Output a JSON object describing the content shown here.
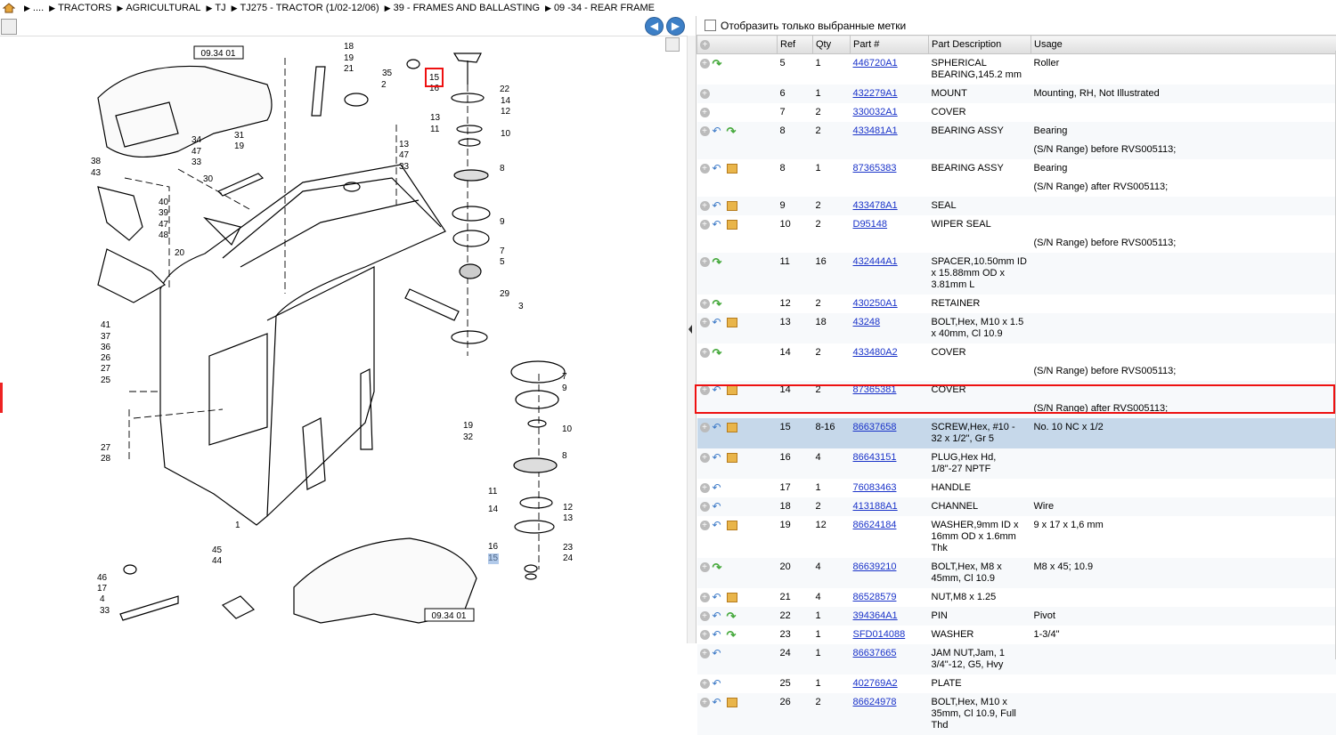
{
  "breadcrumb": [
    "....",
    "TRACTORS",
    "AGRICULTURAL",
    "TJ",
    "TJ275 - TRACTOR (1/02-12/06)",
    "39 - FRAMES AND BALLASTING",
    "09 -34 - REAR FRAME"
  ],
  "filter_label": "Отобразить только выбранные метки",
  "columns": [
    "Ref",
    "Qty",
    "Part #",
    "Part Description",
    "Usage"
  ],
  "drawing": {
    "ref_top": "09.34 01",
    "ref_bottom": "09.34 01",
    "callouts": [
      "18",
      "19",
      "21",
      "35",
      "2",
      "15",
      "16",
      "22",
      "14",
      "12",
      "13",
      "11",
      "10",
      "8",
      "9",
      "7",
      "5",
      "29",
      "3",
      "34",
      "47",
      "33",
      "31",
      "19",
      "38",
      "43",
      "30",
      "40",
      "39",
      "47",
      "48",
      "20",
      "13",
      "47",
      "33",
      "41",
      "37",
      "36",
      "26",
      "27",
      "25",
      "27",
      "28",
      "1",
      "7",
      "9",
      "10",
      "19",
      "32",
      "8",
      "11",
      "12",
      "13",
      "14",
      "16",
      "15",
      "23",
      "24",
      "45",
      "44",
      "46",
      "17",
      "4",
      "33"
    ]
  },
  "rows": [
    {
      "icons": [
        "plus",
        "fwd"
      ],
      "ref": "5",
      "qty": "1",
      "part": "446720A1",
      "desc": "SPHERICAL BEARING,145.2 mm",
      "usage": "Roller"
    },
    {
      "icons": [
        "plus"
      ],
      "ref": "6",
      "qty": "1",
      "part": "432279A1",
      "desc": "MOUNT",
      "usage": "Mounting, RH, Not Illustrated"
    },
    {
      "icons": [
        "plus"
      ],
      "ref": "7",
      "qty": "2",
      "part": "330032A1",
      "desc": "COVER",
      "usage": ""
    },
    {
      "icons": [
        "plus",
        "back",
        "fwd"
      ],
      "ref": "8",
      "qty": "2",
      "part": "433481A1",
      "desc": "BEARING ASSY",
      "usage": "Bearing"
    },
    {
      "note": "(S/N Range) before RVS005113;"
    },
    {
      "icons": [
        "plus",
        "back",
        "box"
      ],
      "ref": "8",
      "qty": "1",
      "part": "87365383",
      "desc": "BEARING ASSY",
      "usage": "Bearing"
    },
    {
      "note": "(S/N Range) after RVS005113;"
    },
    {
      "icons": [
        "plus",
        "back",
        "box"
      ],
      "ref": "9",
      "qty": "2",
      "part": "433478A1",
      "desc": "SEAL",
      "usage": ""
    },
    {
      "icons": [
        "plus",
        "back",
        "box"
      ],
      "ref": "10",
      "qty": "2",
      "part": "D95148",
      "desc": "WIPER SEAL",
      "usage": ""
    },
    {
      "note": "(S/N Range) before RVS005113;"
    },
    {
      "icons": [
        "plus",
        "fwd"
      ],
      "ref": "11",
      "qty": "16",
      "part": "432444A1",
      "desc": "SPACER,10.50mm ID x 15.88mm OD x 3.81mm L",
      "usage": ""
    },
    {
      "icons": [
        "plus",
        "fwd"
      ],
      "ref": "12",
      "qty": "2",
      "part": "430250A1",
      "desc": "RETAINER",
      "usage": ""
    },
    {
      "icons": [
        "plus",
        "back",
        "box"
      ],
      "ref": "13",
      "qty": "18",
      "part": "43248",
      "desc": "BOLT,Hex, M10 x 1.5 x 40mm, Cl 10.9",
      "usage": ""
    },
    {
      "icons": [
        "plus",
        "fwd"
      ],
      "ref": "14",
      "qty": "2",
      "part": "433480A2",
      "desc": "COVER",
      "usage": ""
    },
    {
      "note": "(S/N Range) before RVS005113;"
    },
    {
      "icons": [
        "plus",
        "back",
        "box"
      ],
      "ref": "14",
      "qty": "2",
      "part": "87365381",
      "desc": "COVER",
      "usage": ""
    },
    {
      "note": "(S/N Range) after RVS005113;"
    },
    {
      "icons": [
        "plus",
        "back",
        "box"
      ],
      "ref": "15",
      "qty": "8-16",
      "part": "86637658",
      "desc": "SCREW,Hex, #10 - 32 x 1/2\", Gr 5",
      "usage": "No. 10 NC x 1/2",
      "selected": true
    },
    {
      "icons": [
        "plus",
        "back",
        "box"
      ],
      "ref": "16",
      "qty": "4",
      "part": "86643151",
      "desc": "PLUG,Hex Hd, 1/8\"-27 NPTF",
      "usage": ""
    },
    {
      "icons": [
        "plus",
        "back"
      ],
      "ref": "17",
      "qty": "1",
      "part": "76083463",
      "desc": "HANDLE",
      "usage": ""
    },
    {
      "icons": [
        "plus",
        "back"
      ],
      "ref": "18",
      "qty": "2",
      "part": "413188A1",
      "desc": "CHANNEL",
      "usage": "Wire"
    },
    {
      "icons": [
        "plus",
        "back",
        "box"
      ],
      "ref": "19",
      "qty": "12",
      "part": "86624184",
      "desc": "WASHER,9mm ID x 16mm OD x 1.6mm Thk",
      "usage": "9 x 17 x 1,6 mm"
    },
    {
      "icons": [
        "plus",
        "fwd"
      ],
      "ref": "20",
      "qty": "4",
      "part": "86639210",
      "desc": "BOLT,Hex, M8 x 45mm, Cl 10.9",
      "usage": "M8 x 45; 10.9"
    },
    {
      "icons": [
        "plus",
        "back",
        "box"
      ],
      "ref": "21",
      "qty": "4",
      "part": "86528579",
      "desc": "NUT,M8 x 1.25",
      "usage": ""
    },
    {
      "icons": [
        "plus",
        "back",
        "fwd"
      ],
      "ref": "22",
      "qty": "1",
      "part": "394364A1",
      "desc": "PIN",
      "usage": "Pivot"
    },
    {
      "icons": [
        "plus",
        "back",
        "fwd"
      ],
      "ref": "23",
      "qty": "1",
      "part": "SFD014088",
      "desc": "WASHER",
      "usage": "1-3/4\""
    },
    {
      "icons": [
        "plus",
        "back"
      ],
      "ref": "24",
      "qty": "1",
      "part": "86637665",
      "desc": "JAM NUT,Jam, 1 3/4\"-12, G5, Hvy",
      "usage": ""
    },
    {
      "icons": [
        "plus",
        "back"
      ],
      "ref": "25",
      "qty": "1",
      "part": "402769A2",
      "desc": "PLATE",
      "usage": ""
    },
    {
      "icons": [
        "plus",
        "back",
        "box"
      ],
      "ref": "26",
      "qty": "2",
      "part": "86624978",
      "desc": "BOLT,Hex, M10 x 35mm, Cl 10.9, Full Thd",
      "usage": ""
    }
  ]
}
